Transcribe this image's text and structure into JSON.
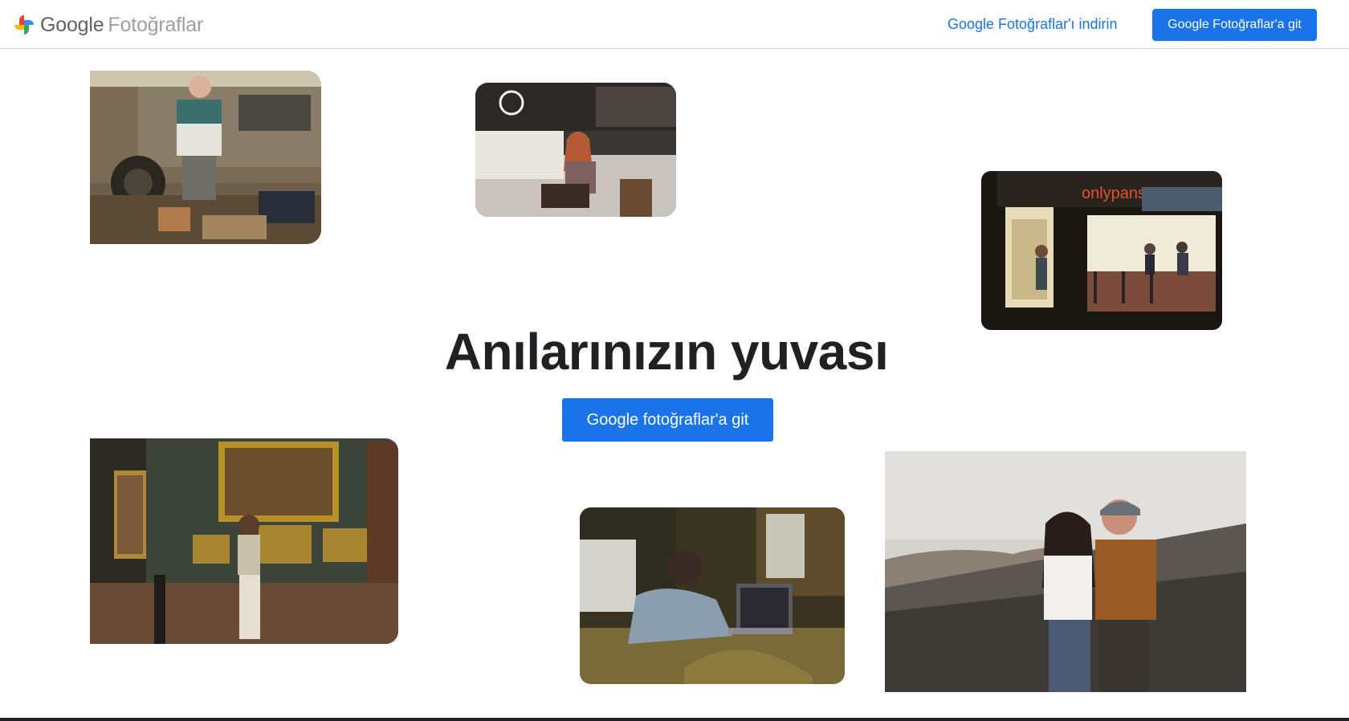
{
  "header": {
    "logo_google": "Google",
    "logo_product": "Fotoğraflar",
    "download_link": "Google Fotoğraflar'ı indirin",
    "go_button": "Google Fotoğraflar'a git"
  },
  "hero": {
    "title": "Anılarınızın yuvası",
    "button": "Google fotoğraflar'a git"
  },
  "photos": [
    {
      "name": "market-vendor-photo"
    },
    {
      "name": "cafe-woman-laptop-photo"
    },
    {
      "name": "night-restaurant-photo"
    },
    {
      "name": "museum-gallery-photo"
    },
    {
      "name": "woman-video-call-photo"
    },
    {
      "name": "couple-outdoors-photo"
    }
  ],
  "photo_text": {
    "restaurant_sign": "onlypans"
  },
  "colors": {
    "accent": "#1a73e8",
    "title": "#202124",
    "logo_text": "#5f6368",
    "logo_product": "#9aa0a6"
  }
}
